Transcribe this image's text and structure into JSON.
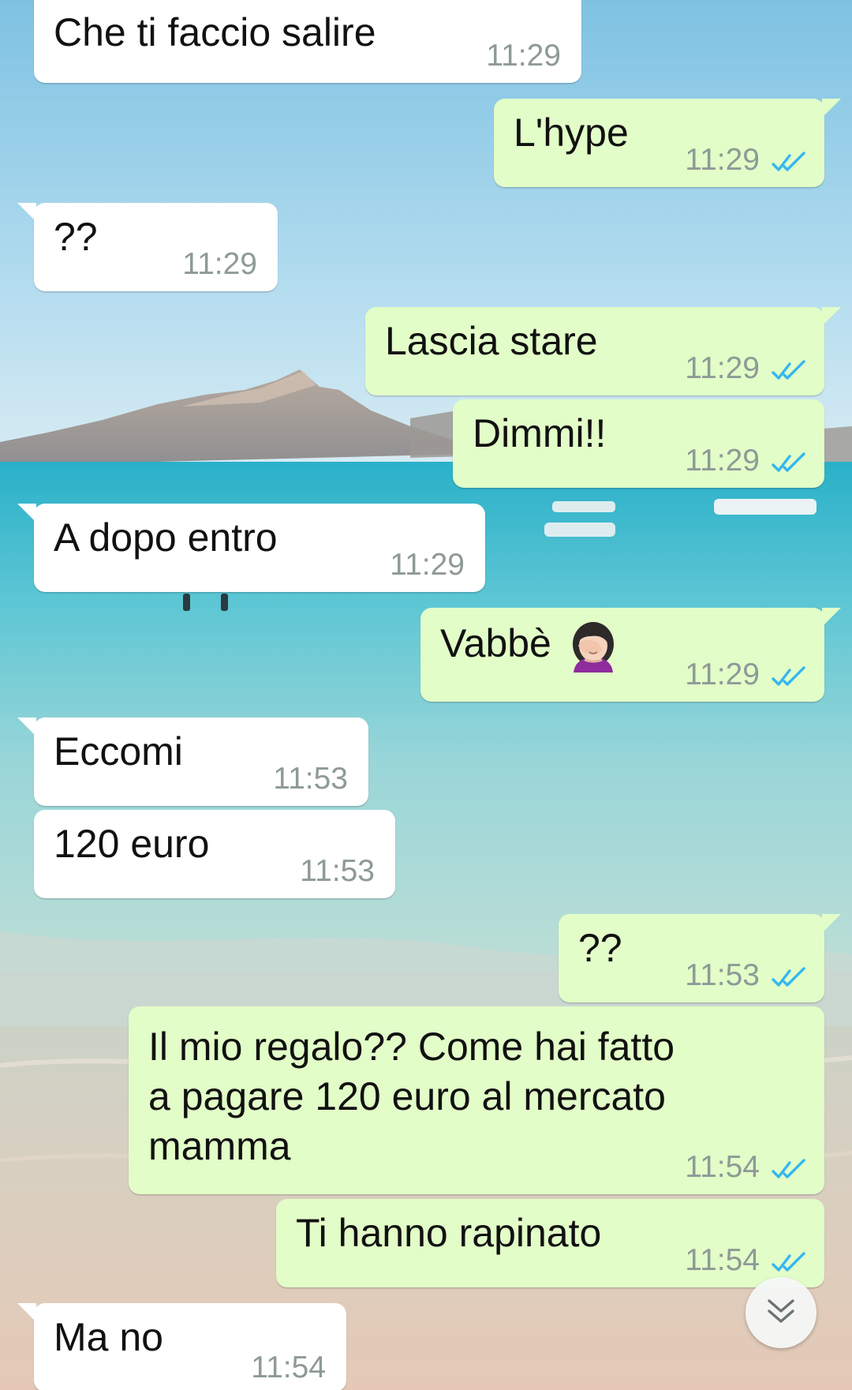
{
  "chat": {
    "messages": [
      {
        "direction": "incoming",
        "text": "Che ti faccio salire",
        "time": "11:29"
      },
      {
        "direction": "outgoing",
        "text": "L'hype",
        "time": "11:29",
        "status": "read"
      },
      {
        "direction": "incoming",
        "text": "??",
        "time": "11:29"
      },
      {
        "direction": "outgoing",
        "text": "Lascia stare",
        "time": "11:29",
        "status": "read"
      },
      {
        "direction": "outgoing",
        "text": "Dimmi!!",
        "time": "11:29",
        "status": "read"
      },
      {
        "direction": "incoming",
        "text": "A dopo entro",
        "time": "11:29"
      },
      {
        "direction": "outgoing",
        "text": "Vabbè",
        "emoji": "woman-facepalming",
        "time": "11:29",
        "status": "read"
      },
      {
        "direction": "incoming",
        "text": "Eccomi",
        "time": "11:53"
      },
      {
        "direction": "incoming",
        "text": "120 euro",
        "time": "11:53"
      },
      {
        "direction": "outgoing",
        "text": "??",
        "time": "11:53",
        "status": "read"
      },
      {
        "direction": "outgoing",
        "text": "Il mio regalo?? Come hai fatto a pagare 120 euro al mercato mamma",
        "time": "11:54",
        "status": "read"
      },
      {
        "direction": "outgoing",
        "text": "Ti hanno rapinato",
        "time": "11:54",
        "status": "read"
      },
      {
        "direction": "incoming",
        "text": "Ma no",
        "time": "11:54"
      }
    ]
  },
  "icons": {
    "read_receipt": "double-check-icon",
    "scroll_down": "chevron-double-down-icon",
    "emoji": "woman-facepalming"
  },
  "colors": {
    "incoming_bubble": "#ffffff",
    "outgoing_bubble": "#e2fdc8",
    "timestamp": "#8e9a96",
    "read_ticks": "#34b7f1"
  },
  "wallpaper": "beach-sea-mountains"
}
